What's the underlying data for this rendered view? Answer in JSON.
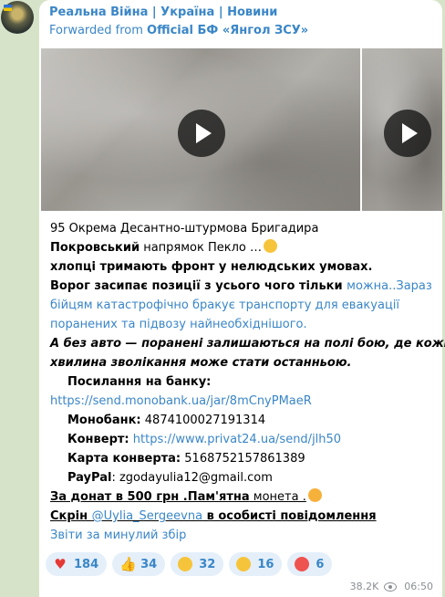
{
  "header": {
    "channel_name": "Реальна Війна | Україна | Новини",
    "forwarded_prefix": "Forwarded from ",
    "forwarded_source": "Official БФ «Янгол ЗСУ»"
  },
  "media": {
    "items": [
      {
        "type": "video",
        "icon": "play-icon"
      },
      {
        "type": "video",
        "icon": "play-icon"
      }
    ]
  },
  "message": {
    "line1": "95 Окрема Десантно-штурмова Бригадира",
    "line2_bold": "Покровський",
    "line2_rest": " напрямок Пекло …",
    "line3": "хлопці тримають фронт у нелюдських умовах.",
    "line4_bold": "Ворог засипає позиції з усього чого тільки ",
    "line4_link": "можна",
    "line4_rest": "..Зараз",
    "line5": "бійцям катастрофічно бракує транспорту для евакуації",
    "line6": "поранених та підвозу найнеобхіднішого.",
    "line7": "А без авто — поранені залишаються на полі бою, де кожна",
    "line8": "хвилина зволікання може стати останньою.",
    "bank_label": "Посилання на банку:",
    "bank_url": "https://send.monobank.ua/jar/8mCnyPMaeR",
    "mono_label": "Монобанк:",
    "mono_value": " 4874100027191314",
    "envelope_label": "Конверт:",
    "envelope_url": "https://www.privat24.ua/send/jlh50",
    "envelope_card_label": "Карта конверта:",
    "envelope_card_value": " 5168752157861389",
    "paypal_label": "PayPal",
    "paypal_value": ": zgodayulia12@gmail.com",
    "donate_line": "За донат в 500 грн .Пам'ятна",
    "donate_rest": " монета .",
    "screen_prefix": "Скрін ",
    "screen_mention": "@Uylia_Sergeevna",
    "screen_rest": " в особисті повідомлення ",
    "report_link": "Звіти за минулий збір"
  },
  "reactions": [
    {
      "icon": "heart-icon",
      "count": "184"
    },
    {
      "icon": "thumbs-up-icon",
      "count": "34"
    },
    {
      "icon": "crying-face-icon",
      "count": "32"
    },
    {
      "icon": "grinning-face-icon",
      "count": "16"
    },
    {
      "icon": "angry-face-icon",
      "count": "6"
    }
  ],
  "meta": {
    "views": "38.2K",
    "time": "06:50"
  },
  "colors": {
    "background": "#d6e3c9",
    "link": "#3a86c7",
    "reaction_bg": "#e4effa"
  }
}
